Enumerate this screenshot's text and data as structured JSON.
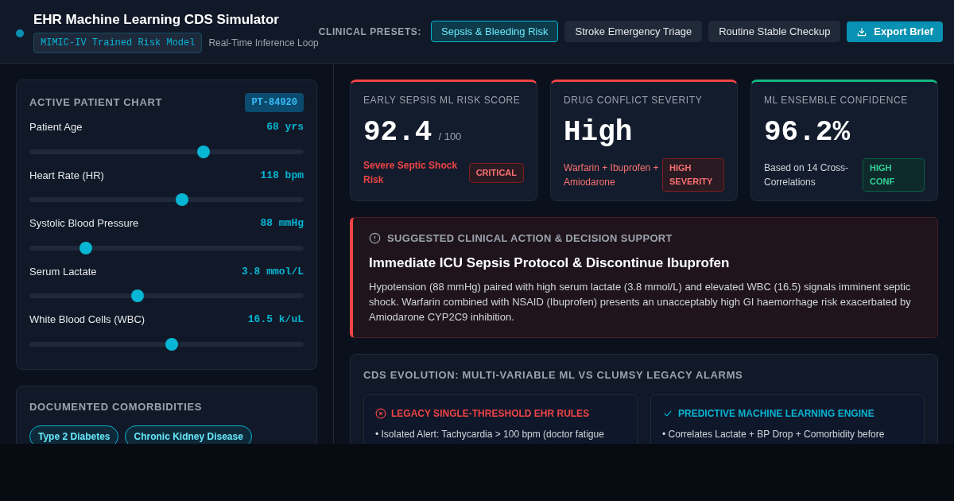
{
  "header": {
    "title": "EHR Machine Learning CDS Simulator",
    "model_badge": "MIMIC-IV Trained Risk Model",
    "subtitle": "Real-Time Inference Loop",
    "presets_label": "CLINICAL PRESETS:",
    "presets": [
      {
        "label": "Sepsis & Bleeding Risk",
        "selected": true
      },
      {
        "label": "Stroke Emergency Triage",
        "selected": false
      },
      {
        "label": "Routine Stable Checkup",
        "selected": false
      }
    ],
    "export_button": "Export Brief"
  },
  "patient_chart": {
    "title": "ACTIVE PATIENT CHART",
    "patient_id": "PT-84920",
    "vitals": [
      {
        "label": "Patient Age",
        "reading": "68 yrs",
        "level": 0.64
      },
      {
        "label": "Heart Rate (HR)",
        "reading": "118 bpm",
        "level": 0.56
      },
      {
        "label": "Systolic Blood Pressure",
        "reading": "88 mmHg",
        "level": 0.19
      },
      {
        "label": "Serum Lactate",
        "reading": "3.8 mmol/L",
        "level": 0.39
      },
      {
        "label": "White Blood Cells (WBC)",
        "reading": "16.5 k/uL",
        "level": 0.52
      }
    ]
  },
  "comorbidities": {
    "title": "DOCUMENTED COMORBIDITIES",
    "tags": [
      "Type 2 Diabetes",
      "Chronic Kidney Disease"
    ]
  },
  "metrics": [
    {
      "title": "EARLY SEPSIS ML RISK SCORE",
      "value": "92.4",
      "suffix": "/ 100",
      "note": "Severe Septic Shock Risk",
      "badge": "CRITICAL",
      "color": "#ef4444"
    },
    {
      "title": "DRUG CONFLICT SEVERITY",
      "value": "High",
      "note": "Warfarin + Ibuprofen + Amiodarone",
      "badge": "HIGH SEVERITY",
      "color": "#ef4444"
    },
    {
      "title": "ML ENSEMBLE CONFIDENCE",
      "value": "96.2%",
      "note": "Based on 14 Cross-Correlations",
      "badge": "HIGH CONF",
      "color": "#10b981"
    }
  ],
  "action": {
    "heading": "SUGGESTED CLINICAL ACTION & DECISION SUPPORT",
    "title": "Immediate ICU Sepsis Protocol & Discontinue Ibuprofen",
    "body": "Hypotension (88 mmHg) paired with high serum lactate (3.8 mmol/L) and elevated WBC (16.5) signals imminent septic shock. Warfarin combined with NSAID (Ibuprofen) presents an unacceptably high GI haemorrhage risk exacerbated by Amiodarone CYP2C9 inhibition."
  },
  "comparison": {
    "title": "CDS EVOLUTION: MULTI-VARIABLE ML VS CLUMSY LEGACY ALARMS",
    "columns": [
      {
        "kind": "legacy",
        "title": "LEGACY SINGLE-THRESHOLD EHR RULES",
        "items": [
          "• Isolated Alert: Tachycardia > 100 bpm (doctor fatigue"
        ]
      },
      {
        "kind": "ml",
        "title": "PREDICTIVE MACHINE LEARNING ENGINE",
        "items": [
          "• Correlates Lactate + BP Drop + Comorbidity before"
        ]
      }
    ]
  }
}
